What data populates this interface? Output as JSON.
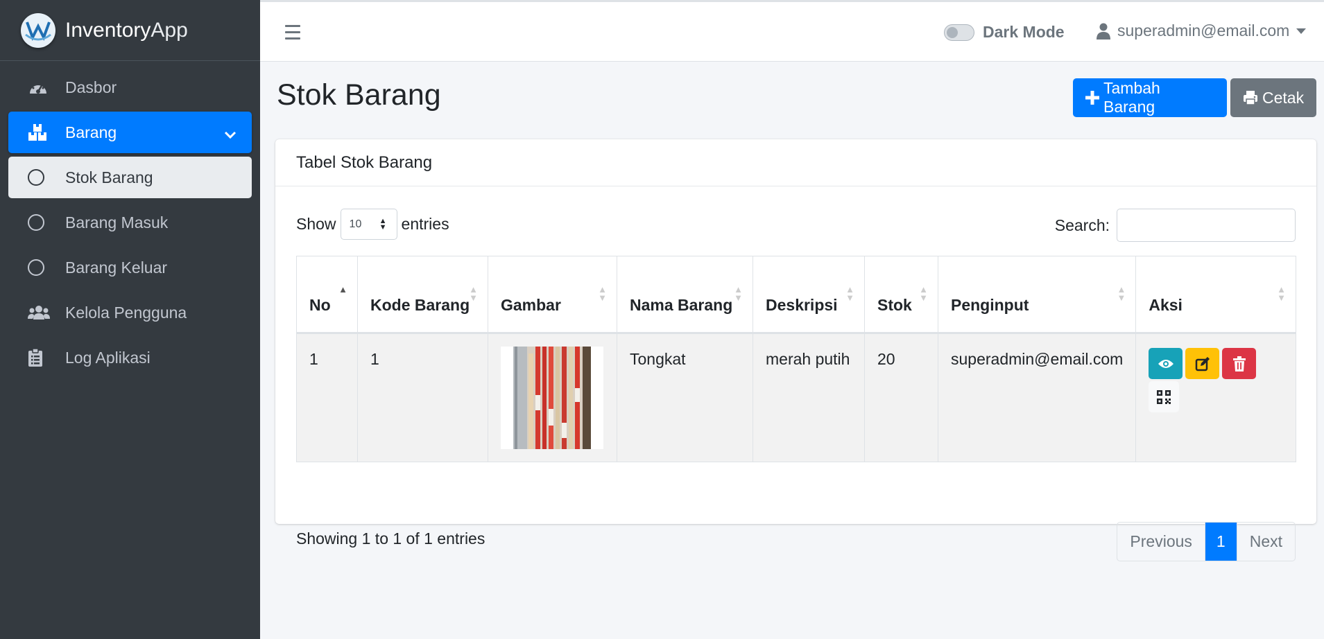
{
  "app": {
    "brand_main": "Inventory",
    "brand_sub": "App"
  },
  "sidebar": {
    "items": [
      {
        "label": "Dasbor",
        "icon": "tachometer-icon"
      },
      {
        "label": "Barang",
        "icon": "boxes-icon",
        "active": true
      },
      {
        "label": "Stok Barang",
        "icon": "circle-icon",
        "active": true
      },
      {
        "label": "Barang Masuk",
        "icon": "circle-icon"
      },
      {
        "label": "Barang Keluar",
        "icon": "circle-icon"
      },
      {
        "label": "Kelola Pengguna",
        "icon": "users-icon"
      },
      {
        "label": "Log Aplikasi",
        "icon": "clipboard-list-icon"
      }
    ]
  },
  "topbar": {
    "dark_mode_label": "Dark Mode",
    "dark_mode_on": false,
    "user_email": "superadmin@email.com"
  },
  "page": {
    "title": "Stok Barang",
    "add_button": "Tambah Barang",
    "print_button": "Cetak"
  },
  "card": {
    "title": "Tabel Stok Barang",
    "show_label": "Show",
    "entries_value": "10",
    "entries_label": "entries",
    "search_label": "Search:",
    "search_value": "",
    "columns": [
      "No",
      "Kode Barang",
      "Gambar",
      "Nama Barang",
      "Deskripsi",
      "Stok",
      "Penginput",
      "Aksi"
    ],
    "rows": [
      {
        "no": "1",
        "kode": "1",
        "nama": "Tongkat",
        "deskripsi": "merah putih",
        "stok": "20",
        "penginput": "superadmin@email.com"
      }
    ],
    "info": "Showing 1 to 1 of 1 entries",
    "pagination": {
      "previous": "Previous",
      "current": "1",
      "next": "Next"
    }
  },
  "colors": {
    "sidebar": "#343a40",
    "primary": "#007bff",
    "secondary": "#6c757d",
    "info": "#17a2b8",
    "warning": "#ffc107",
    "danger": "#dc3545"
  }
}
